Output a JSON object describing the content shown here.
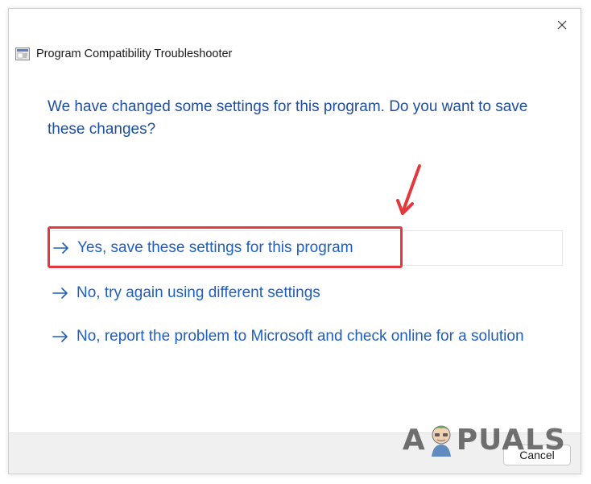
{
  "window": {
    "title": "Program Compatibility Troubleshooter",
    "close_icon": "close-icon",
    "app_icon": "troubleshooter-app-icon"
  },
  "main": {
    "heading": "We have changed some settings for this program. Do you want to save these changes?",
    "options": [
      {
        "label": "Yes, save these settings for this program",
        "icon": "arrow-right-icon",
        "selected": true
      },
      {
        "label": "No, try again using different settings",
        "icon": "arrow-right-icon",
        "selected": false
      },
      {
        "label": "No, report the problem to Microsoft and check online for a solution",
        "icon": "arrow-right-icon",
        "selected": false
      }
    ]
  },
  "footer": {
    "cancel_label": "Cancel"
  },
  "annotation": {
    "highlight_color": "#e03a3e",
    "pointer_icon": "red-pointer-arrow-icon"
  },
  "watermark": {
    "text_left": "A",
    "text_right": "PUALS",
    "mascot_icon": "appuals-mascot-icon"
  },
  "colors": {
    "heading": "#1f4e9c",
    "link": "#1f5fbf",
    "footer_bg": "#f0f0f0"
  }
}
